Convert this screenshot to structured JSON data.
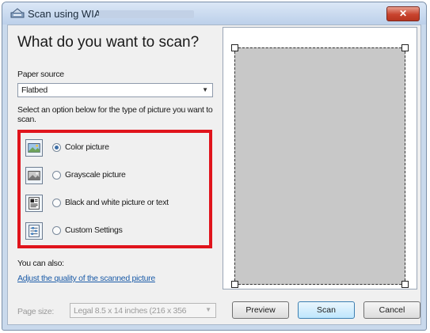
{
  "window": {
    "title": "Scan using WIA",
    "close_label": "✕"
  },
  "main": {
    "heading": "What do you want to scan?",
    "paper_source_label": "Paper source",
    "paper_source_value": "Flatbed",
    "instruction": "Select an option below for the type of picture you want to scan.",
    "options": [
      {
        "label": "Color picture",
        "selected": true,
        "icon": "color-picture-icon"
      },
      {
        "label": "Grayscale picture",
        "selected": false,
        "icon": "grayscale-picture-icon"
      },
      {
        "label": "Black and white picture or text",
        "selected": false,
        "icon": "bw-picture-icon"
      },
      {
        "label": "Custom Settings",
        "selected": false,
        "icon": "custom-settings-icon"
      }
    ],
    "also_label": "You can also:",
    "adjust_link": "Adjust the quality of the scanned picture",
    "page_size_label": "Page size:",
    "page_size_value": "Legal 8.5 x 14 inches (216 x 356"
  },
  "buttons": {
    "preview": "Preview",
    "scan": "Scan",
    "cancel": "Cancel"
  },
  "colors": {
    "highlight_border": "#e0141c",
    "link": "#1c5ca8",
    "scan_area": "#c8c8c8"
  }
}
